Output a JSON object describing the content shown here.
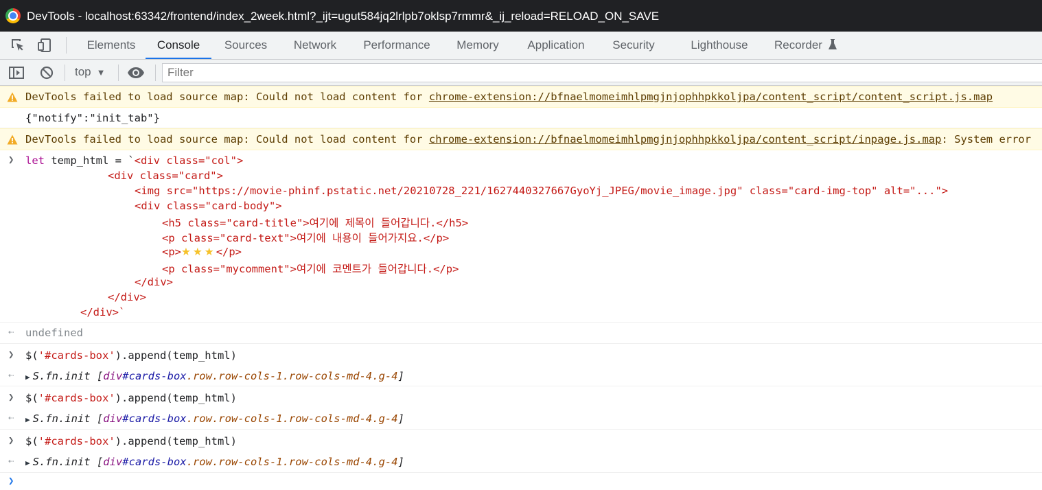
{
  "window": {
    "title": "DevTools - localhost:63342/frontend/index_2week.html?_ijt=ugut584jq2lrlpb7oklsp7rmmr&_ij_reload=RELOAD_ON_SAVE"
  },
  "tabs": [
    {
      "label": "Elements"
    },
    {
      "label": "Console",
      "active": true
    },
    {
      "label": "Sources"
    },
    {
      "label": "Network"
    },
    {
      "label": "Performance"
    },
    {
      "label": "Memory"
    },
    {
      "label": "Application"
    },
    {
      "label": "Security"
    },
    {
      "label": "Lighthouse"
    },
    {
      "label": "Recorder"
    }
  ],
  "recorder_badge": "flask-icon",
  "toolbar": {
    "context": "top",
    "filter_placeholder": "Filter"
  },
  "console": {
    "warning1": {
      "prefix": "DevTools failed to load source map: Could not load content for ",
      "url": "chrome-extension://bfnaelmomeimhlpmgjnjophhpkkoljpa/content_script/content_script.js.map"
    },
    "notify_log": "{\"notify\":\"init_tab\"}",
    "warning2": {
      "prefix": "DevTools failed to load source map: Could not load content for ",
      "url": "chrome-extension://bfnaelmomeimhlpmgjnjophhpkkoljpa/content_script/inpage.js.map",
      "suffix": ": System error"
    },
    "input1": {
      "kw": "let",
      "rest": " temp_html = `",
      "lines": [
        {
          "text": "<div class=\"col\">"
        },
        {
          "text": "<div class=\"card\">"
        },
        {
          "text": "<img src=\"https://movie-phinf.pstatic.net/20210728_221/1627440327667GyoYj_JPEG/movie_image.jpg\" class=\"card-img-top\" alt=\"...\">"
        },
        {
          "text": "<div class=\"card-body\">"
        },
        {
          "text": "<h5 class=\"card-title\">여기에 제목이 들어갑니다.</h5>"
        },
        {
          "text": "<p class=\"card-text\">여기에 내용이 들어가지요.</p>"
        },
        {
          "text": "<p>",
          "stars": "★★★",
          "close": "</p>"
        },
        {
          "text": "<p class=\"mycomment\">여기에 코멘트가 들어갑니다.</p>"
        },
        {
          "text": "</div>"
        },
        {
          "text": "</div>"
        },
        {
          "text": "</div>`"
        }
      ]
    },
    "undefined_output": "undefined",
    "append_command": {
      "pre": "$(",
      "arg": "'#cards-box'",
      "post": ").append(temp_html)"
    },
    "append_result": {
      "obj": "S.fn.init ",
      "open": "[",
      "tag": "div",
      "id": "#cards-box",
      "classes": ".row.row-cols-1.row-cols-md-4.g-4",
      "close": "]"
    }
  },
  "colors": {
    "accent": "#1a73e8",
    "warning_bg": "#fffbe5",
    "warning_text": "#5c3c00",
    "titlebar": "#202124"
  }
}
